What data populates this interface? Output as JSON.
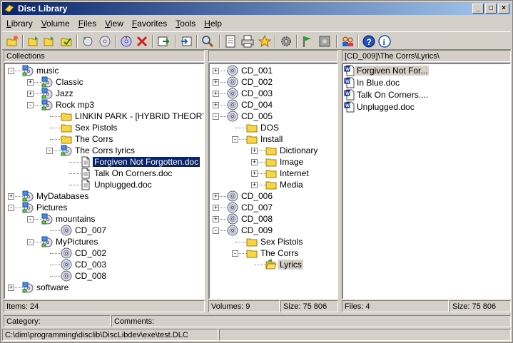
{
  "window": {
    "title": "Disc Library"
  },
  "menu": [
    {
      "label": "Library",
      "u": "L",
      "rest": "ibrary"
    },
    {
      "label": "Volume",
      "u": "V",
      "rest": "olume"
    },
    {
      "label": "Files",
      "u": "F",
      "rest": "iles"
    },
    {
      "label": "View",
      "u": "V",
      "rest": "iew"
    },
    {
      "label": "Favorites",
      "u": "F",
      "rest": "avorites"
    },
    {
      "label": "Tools",
      "u": "T",
      "rest": "ools"
    },
    {
      "label": "Help",
      "u": "H",
      "rest": "elp"
    }
  ],
  "toolbar": {
    "buttons": [
      "new-library-icon",
      "open-folder-icon",
      "open-folder-icon",
      "checked-folder-icon",
      "refresh-disc-icon",
      "disc-icon",
      "scan-disc-icon",
      "delete-icon",
      "export-icon",
      "import-icon",
      "search-icon",
      "properties-icon",
      "print-icon",
      "favorites-star-icon",
      "settings-gear-icon",
      "flag-icon",
      "info-panel-icon",
      "users-icon",
      "help-icon",
      "about-icon"
    ]
  },
  "colors": {
    "title_start": "#0a246a",
    "title_end": "#a6caf0",
    "selection": "#0a246a",
    "folder": "#f7d54a",
    "disc": "#c8c8d8"
  },
  "collections": {
    "header": "Collections",
    "nodes": [
      {
        "label": "music",
        "icon": "disc-group-icon",
        "exp": "-"
      },
      {
        "label": "Classic",
        "icon": "disc-group-icon",
        "exp": "+"
      },
      {
        "label": "Jazz",
        "icon": "disc-group-icon",
        "exp": "+"
      },
      {
        "label": "Rock mp3",
        "icon": "disc-group-icon",
        "exp": "-"
      },
      {
        "label": "LINKIN PARK - [HYBRID THEORY]",
        "icon": "folder-icon",
        "exp": ""
      },
      {
        "label": "Sex Pistols",
        "icon": "folder-icon",
        "exp": ""
      },
      {
        "label": "The Corrs",
        "icon": "folder-icon",
        "exp": ""
      },
      {
        "label": "The Corrs lyrics",
        "icon": "disc-group-icon",
        "exp": "-"
      },
      {
        "label": "Forgiven Not Forgotten.doc",
        "icon": "document-icon",
        "exp": "",
        "state": "sel"
      },
      {
        "label": "Talk On Corners.doc",
        "icon": "document-icon",
        "exp": ""
      },
      {
        "label": "Unplugged.doc",
        "icon": "document-icon",
        "exp": ""
      },
      {
        "label": "MyDatabases",
        "icon": "disc-group-icon",
        "exp": "+"
      },
      {
        "label": "Pictures",
        "icon": "disc-group-icon",
        "exp": "-"
      },
      {
        "label": "mountains",
        "icon": "disc-group-icon",
        "exp": "-"
      },
      {
        "label": "CD_007",
        "icon": "disc-icon",
        "exp": ""
      },
      {
        "label": "MyPictures",
        "icon": "disc-group-icon",
        "exp": "-"
      },
      {
        "label": "CD_002",
        "icon": "disc-icon",
        "exp": ""
      },
      {
        "label": "CD_003",
        "icon": "disc-icon",
        "exp": ""
      },
      {
        "label": "CD_008",
        "icon": "disc-icon",
        "exp": ""
      },
      {
        "label": "software",
        "icon": "disc-group-icon",
        "exp": "+"
      }
    ]
  },
  "volumes": {
    "header": "",
    "nodes": [
      {
        "label": "CD_001",
        "icon": "disc-icon",
        "exp": "+"
      },
      {
        "label": "CD_002",
        "icon": "disc-icon",
        "exp": "+"
      },
      {
        "label": "CD_003",
        "icon": "disc-icon",
        "exp": "+"
      },
      {
        "label": "CD_004",
        "icon": "disc-icon",
        "exp": "+"
      },
      {
        "label": "CD_005",
        "icon": "disc-icon",
        "exp": "-"
      },
      {
        "label": "DOS",
        "icon": "folder-icon",
        "exp": ""
      },
      {
        "label": "Install",
        "icon": "folder-icon",
        "exp": "-"
      },
      {
        "label": "Dictionary",
        "icon": "folder-icon",
        "exp": "+"
      },
      {
        "label": "Image",
        "icon": "folder-icon",
        "exp": "+"
      },
      {
        "label": "Internet",
        "icon": "folder-icon",
        "exp": "+"
      },
      {
        "label": "Media",
        "icon": "folder-icon",
        "exp": "+"
      },
      {
        "label": "CD_006",
        "icon": "disc-icon",
        "exp": "+"
      },
      {
        "label": "CD_007",
        "icon": "disc-icon",
        "exp": "+"
      },
      {
        "label": "CD_008",
        "icon": "disc-icon",
        "exp": "+"
      },
      {
        "label": "CD_009",
        "icon": "disc-icon",
        "exp": "-"
      },
      {
        "label": "Sex Pistols",
        "icon": "folder-icon",
        "exp": ""
      },
      {
        "label": "The Corrs",
        "icon": "folder-icon",
        "exp": "-"
      },
      {
        "label": "Lyrics",
        "icon": "open-folder-icon",
        "exp": "",
        "state": "hl"
      }
    ]
  },
  "files": {
    "header": "[CD_009]\\The Corrs\\Lyrics\\",
    "items": [
      {
        "label": "Forgiven Not For...",
        "icon": "word-document-icon",
        "state": "hl"
      },
      {
        "label": "In Blue.doc",
        "icon": "word-document-icon"
      },
      {
        "label": "Talk On Corners....",
        "icon": "word-document-icon"
      },
      {
        "label": "Unplugged.doc",
        "icon": "word-document-icon"
      }
    ]
  },
  "status": {
    "items": "Items: 24",
    "volumes": "Volumes: 9",
    "volumes_size": "Size: 75 806",
    "files": "Files: 4",
    "files_size": "Size: 75 806",
    "category": "Category:",
    "comments": "Comments:",
    "path": "C:\\dim\\programming\\disclib\\DiscLibdev\\exe\\test.DLC"
  }
}
